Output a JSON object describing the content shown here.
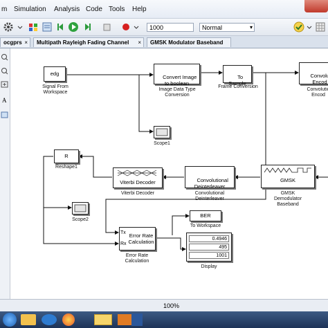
{
  "menubar": {
    "items": [
      "m",
      "Simulation",
      "Analysis",
      "Code",
      "Tools",
      "Help"
    ]
  },
  "toolbar": {
    "stop_time": "1000",
    "sim_mode": "Normal"
  },
  "tabs": [
    {
      "label": "ocgprs"
    },
    {
      "label": "Multipath Rayleigh Fading Channel"
    },
    {
      "label": "GMSK Modulator Baseband"
    }
  ],
  "blocks": {
    "signal_from_ws": {
      "text": "edg",
      "label": "Signal From\nWorkspace"
    },
    "convert_image": {
      "text": "Convert Image\nto boolean",
      "label": "Image Data Type\nConversion"
    },
    "to_sample": {
      "text": "To\nSample",
      "label": "Frame Conversion"
    },
    "conv_encoder": {
      "text": "Convolutio\nEncod",
      "label": "Convolutio\nEncod"
    },
    "scope1": {
      "label": "Scope1"
    },
    "reshape": {
      "text": "R",
      "label": "Reshape1"
    },
    "viterbi": {
      "text": "Viterbi Decoder",
      "label": "Viterbi Decoder"
    },
    "deinterleaver": {
      "text": "Convolutional\nDeinterleaver",
      "label": "Convolutional\nDeinterleaver"
    },
    "gmsk_demod": {
      "text": "GMSK",
      "label": "GMSK\nDemodulator\nBaseband"
    },
    "scope2": {
      "label": "Scope2"
    },
    "error_rate": {
      "port_tx": "Tx",
      "port_rx": "Rx",
      "text": "Error Rate\nCalculation",
      "label": "Error Rate\nCalculation"
    },
    "ber": {
      "text": "BER",
      "label": "To Workspace"
    },
    "display": {
      "values": [
        "0.4946",
        "495",
        "1001"
      ],
      "label": "Display"
    }
  },
  "status": {
    "zoom": "100%"
  }
}
